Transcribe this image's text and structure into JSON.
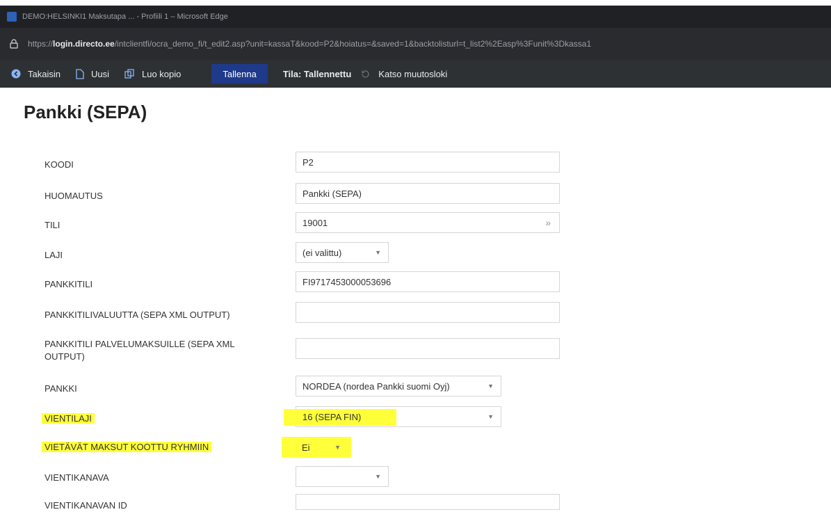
{
  "window": {
    "title": "DEMO:HELSINKI1 Maksutapa ... - Profiili 1 – Microsoft Edge"
  },
  "address": {
    "url_prefix": "https://",
    "url_host": "login.directo.ee",
    "url_path": "/intclientfi/ocra_demo_fi/t_edit2.asp?unit=kassaT&kood=P2&hoiatus=&saved=1&backtolisturl=t_list2%2Easp%3Funit%3Dkassa1"
  },
  "toolbar": {
    "back_label": "Takaisin",
    "new_label": "Uusi",
    "copy_label": "Luo kopio",
    "save_label": "Tallenna",
    "status_label": "Tila: Tallennettu",
    "history_label": "Katso muutosloki"
  },
  "page": {
    "title": "Pankki (SEPA)"
  },
  "form": {
    "koodi": {
      "label": "KOODI",
      "value": "P2"
    },
    "huomautus": {
      "label": "HUOMAUTUS",
      "value": "Pankki (SEPA)"
    },
    "tili": {
      "label": "TILI",
      "value": "19001"
    },
    "laji": {
      "label": "LAJI",
      "value": "(ei valittu)"
    },
    "pankkitili": {
      "label": "PANKKITILI",
      "value": "FI9717453000053696"
    },
    "valuutta": {
      "label": "PANKKITILIVALUUTTA (SEPA XML OUTPUT)",
      "value": ""
    },
    "palvelumaksut": {
      "label": "PANKKITILI PALVELUMAKSUILLE (SEPA XML OUTPUT)",
      "value": ""
    },
    "pankki": {
      "label": "PANKKI",
      "value": "NORDEA (nordea Pankki suomi Oyj)"
    },
    "vientilaji": {
      "label": "VIENTILAJI",
      "value": "16 (SEPA FIN)"
    },
    "ryhmiin": {
      "label": "VIETÄVÄT MAKSUT KOOTTU RYHMIIN",
      "value": "Ei"
    },
    "vientikanava": {
      "label": "VIENTIKANAVA",
      "value": ""
    },
    "vientikanava_id": {
      "label": "VIENTIKANAVAN ID",
      "value": ""
    }
  },
  "colors": {
    "highlight": "#ffff3a",
    "save_button": "#1f3a8a",
    "toolbar_bg": "#2e3134"
  },
  "icons": {
    "back": "back-arrow-icon",
    "new": "new-document-icon",
    "copy": "copy-icon",
    "history": "history-icon",
    "lock": "lock-icon"
  }
}
